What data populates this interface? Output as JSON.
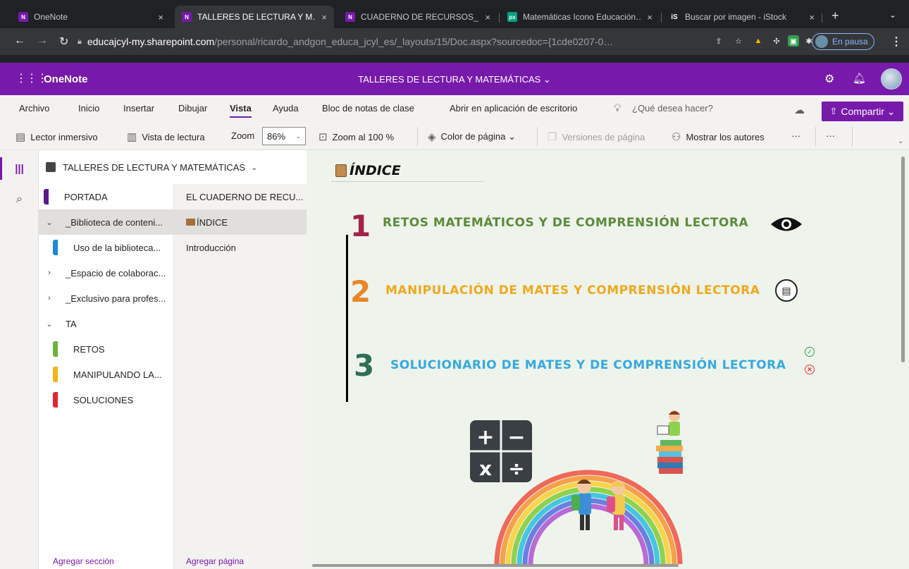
{
  "browser": {
    "tabs": [
      {
        "title": "OneNote",
        "close": "×",
        "favicon_color": "#7719aa",
        "favicon_text": "N"
      },
      {
        "title": "TALLERES DE LECTURA Y M…",
        "close": "×",
        "favicon_color": "#7719aa",
        "favicon_text": "N"
      },
      {
        "title": "CUADERNO DE RECURSOS_…",
        "close": "×",
        "favicon_color": "#7719aa",
        "favicon_text": "N"
      },
      {
        "title": "Matemáticas Icono Educación…",
        "close": "×",
        "favicon_color": "#05a081",
        "favicon_text": "PX"
      },
      {
        "title": "Buscar por imagen - iStock",
        "close": "×",
        "favicon_color": "#202124",
        "favicon_text": "iS"
      }
    ],
    "new_tab": "+",
    "url_host": "educajcyl-my.sharepoint.com",
    "url_path": "/personal/ricardo_andgon_educa_jcyl_es/_layouts/15/Doc.aspx?sourcedoc={1cde0207-0…",
    "profile_status": "En pausa"
  },
  "app": {
    "name": "OneNote",
    "document_title": "TALLERES DE LECTURA Y MATEMÁTICAS ⌄",
    "accent_color": "#7719aa"
  },
  "ribbon": {
    "menus": [
      "Archivo",
      "Inicio",
      "Insertar",
      "Dibujar",
      "Vista",
      "Ayuda",
      "Bloc de notas de clase",
      "Abrir en aplicación de escritorio"
    ],
    "search_placeholder": "¿Qué desea hacer?",
    "share_label": "Compartir ⌄",
    "tools": {
      "immersive_reader": "Lector inmersivo",
      "reading_view": "Vista de lectura",
      "zoom_label": "Zoom",
      "zoom_value": "86%",
      "zoom_100": "Zoom al 100 %",
      "page_color": "Color de página ⌄",
      "page_versions": "Versiones de página",
      "show_authors": "Mostrar los autores",
      "more1": "···",
      "more2": "···"
    }
  },
  "notebook": {
    "name": "TALLERES DE LECTURA Y MATEMÁTICAS",
    "sections": [
      {
        "label": "PORTADA",
        "color": "#5a1a8c",
        "kind": "section"
      },
      {
        "label": "_Biblioteca de conteni...",
        "kind": "group",
        "chevron": "⌄"
      },
      {
        "label": "Uso de la biblioteca...",
        "color": "#1b8ad9",
        "kind": "subsection"
      },
      {
        "label": "_Espacio de colaborac...",
        "kind": "group",
        "chevron": "›"
      },
      {
        "label": "_Exclusivo para profes...",
        "kind": "group",
        "chevron": "›"
      },
      {
        "label": "TA",
        "kind": "group",
        "chevron": "⌄"
      },
      {
        "label": "RETOS",
        "color": "#6cb33f",
        "kind": "subsection"
      },
      {
        "label": "MANIPULANDO LA...",
        "color": "#f4b41a",
        "kind": "subsection"
      },
      {
        "label": "SOLUCIONES",
        "color": "#e3262f",
        "kind": "subsection"
      }
    ],
    "add_section": "Agregar sección",
    "pages": [
      {
        "label": "EL CUADERNO DE RECU..."
      },
      {
        "label": "ÍNDICE"
      },
      {
        "label": "Introducción"
      }
    ],
    "add_page": "Agregar página"
  },
  "page": {
    "title": "ÍNDICE",
    "items": [
      {
        "number": "1",
        "text": "RETOS MATEMÁTICOS Y DE COMPRENSIÓN LECTORA",
        "color": "#5e8a3a",
        "number_color": "#a3214a"
      },
      {
        "number": "2",
        "text": "MANIPULACIÓN DE MATES Y COMPRENSIÓN LECTORA",
        "color": "#f0a81e",
        "number_color": "#e8862a"
      },
      {
        "number": "3",
        "text": "SOLUCIONARIO DE MATES Y DE COMPRENSIÓN LECTORA",
        "color": "#36a9e1",
        "number_color": "#2f6e57"
      }
    ],
    "calculator_symbols": [
      "+",
      "−",
      "x",
      "÷"
    ]
  }
}
